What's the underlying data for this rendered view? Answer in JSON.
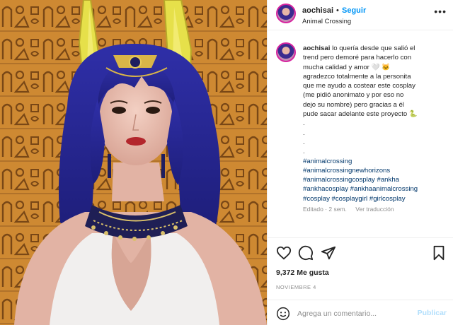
{
  "post": {
    "username": "aochisai",
    "separator": "•",
    "follow_label": "Seguir",
    "location": "Animal Crossing",
    "more_label": "•••"
  },
  "caption": {
    "username": "aochisai",
    "lines": [
      "lo quería desde que salió el",
      "trend pero demoré para hacerlo con",
      "mucha calidad y amor 🤍 🐱",
      "agradezco totalmente a la personita",
      "que me ayudo a costear este cosplay",
      "(me pidió anonimato y por eso no",
      "dejo su nombre) pero gracias a él",
      "pude sacar adelante este proyecto 🐍",
      ".",
      ".",
      ".",
      "."
    ],
    "hashtags": [
      "#animalcrossing",
      "#animalcrossingnewhorizons",
      "#animalcrossingcosplay #ankha",
      "#ankhacosplay #ankhaanimalcrossing",
      "#cosplay #cosplaygirl #girlcosplay"
    ],
    "edited": "Editado · 2 sem.",
    "see_translation": "Ver traducción"
  },
  "actions": {
    "like_icon": "heart-icon",
    "comment_icon": "comment-icon",
    "share_icon": "paper-plane-icon",
    "save_icon": "bookmark-icon"
  },
  "likes": "9,372 Me gusta",
  "date": "NOVIEMBRE 4",
  "comment_box": {
    "emoji_icon": "smiley-icon",
    "placeholder": "Agrega un comentario...",
    "post_label": "Publicar",
    "post_color": "#b2dffc"
  },
  "colors": {
    "follow_blue": "#0095f6",
    "hashtag_blue": "#00376b",
    "wall_orange": "#c9832e",
    "wig_blue": "#2a2a9a",
    "ear_yellow": "#e6e04a"
  }
}
